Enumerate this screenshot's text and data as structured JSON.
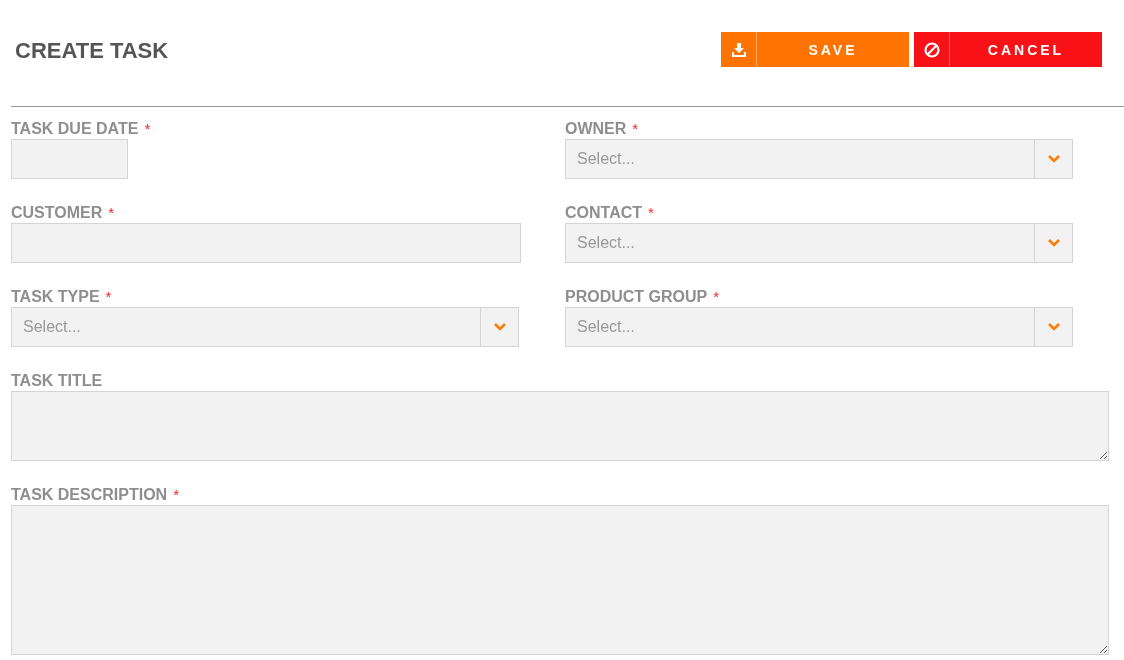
{
  "page_title": "CREATE TASK",
  "buttons": [
    {
      "kind": "save",
      "label": "SAVE"
    },
    {
      "kind": "cancel",
      "label": "CANCEL"
    }
  ],
  "fields": [
    {
      "kind": "date",
      "label": "TASK DUE DATE",
      "required_mark": "*"
    },
    {
      "kind": "select",
      "label": "OWNER",
      "required_mark": "*",
      "placeholder": "Select..."
    },
    {
      "kind": "text",
      "label": "CUSTOMER",
      "required_mark": "*"
    },
    {
      "kind": "select",
      "label": "CONTACT",
      "required_mark": "*",
      "placeholder": "Select..."
    },
    {
      "kind": "select",
      "label": "TASK TYPE",
      "required_mark": "*",
      "placeholder": "Select..."
    },
    {
      "kind": "select",
      "label": "PRODUCT GROUP",
      "required_mark": "*",
      "placeholder": "Select..."
    },
    {
      "kind": "textarea",
      "label": "TASK TITLE"
    },
    {
      "kind": "tall_textarea",
      "label": "TASK DESCRIPTION",
      "required_mark": "*"
    }
  ]
}
